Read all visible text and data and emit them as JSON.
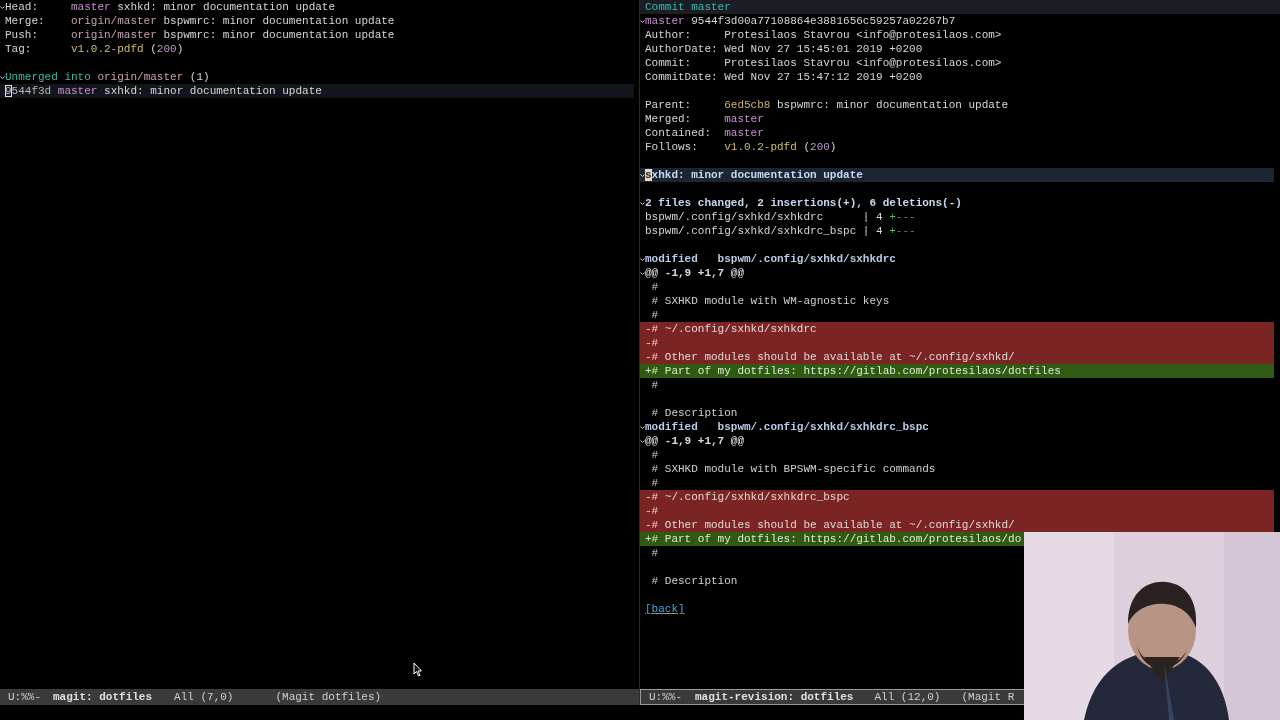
{
  "left": {
    "active": false,
    "lines": [
      {
        "kind": "field",
        "expanded": true,
        "label": "Head:",
        "segments": [
          {
            "kind": "branch",
            "t": "master"
          },
          {
            "kind": "text",
            "t": " sxhkd: minor documentation update"
          }
        ]
      },
      {
        "kind": "field",
        "label": "Merge:",
        "segments": [
          {
            "kind": "remote",
            "t": "origin/master"
          },
          {
            "kind": "text",
            "t": " bspwmrc: minor documentation update"
          }
        ]
      },
      {
        "kind": "field",
        "label": "Push:",
        "segments": [
          {
            "kind": "remote",
            "t": "origin/master"
          },
          {
            "kind": "text",
            "t": " bspwmrc: minor documentation update"
          }
        ]
      },
      {
        "kind": "field",
        "label": "Tag:",
        "segments": [
          {
            "kind": "tag",
            "t": "v1.0.2-pdfd"
          },
          {
            "kind": "text",
            "t": " ("
          },
          {
            "kind": "count",
            "t": "200"
          },
          {
            "kind": "text",
            "t": ")"
          }
        ]
      },
      {
        "kind": "blank"
      },
      {
        "kind": "plain",
        "expanded": true,
        "segments": [
          {
            "kind": "section",
            "t": "Unmerged into "
          },
          {
            "kind": "remote",
            "t": "origin/master"
          },
          {
            "kind": "text",
            "t": " (1)"
          }
        ]
      },
      {
        "kind": "current",
        "cursor": true,
        "segments": [
          {
            "kind": "hash",
            "t": "9544f3d"
          },
          {
            "kind": "branch",
            "t": " master"
          },
          {
            "kind": "text",
            "t": " sxhkd: minor documentation update"
          }
        ]
      }
    ],
    "mode_line": [
      {
        "t": "U:%%-",
        "bold": false
      },
      {
        "t": "magit: dotfiles",
        "bold": true
      },
      {
        "t": "All (7,0)",
        "bold": false
      },
      {
        "t": "(Magit dotfiles)",
        "bold": false
      }
    ]
  },
  "right": {
    "active": true,
    "header": "Commit master",
    "lines": [
      {
        "kind": "plain",
        "expanded": true,
        "segments": [
          {
            "kind": "branch",
            "t": "master"
          },
          {
            "kind": "text",
            "t": " 9544f3d00a77108864e3881656c59257a02267b7"
          }
        ]
      },
      {
        "kind": "field",
        "label": "Author:",
        "segments": [
          {
            "kind": "text",
            "t": "Protesilaos Stavrou <info@protesilaos.com>"
          }
        ]
      },
      {
        "kind": "field",
        "label": "AuthorDate:",
        "segments": [
          {
            "kind": "text",
            "t": "Wed Nov 27 15:45:01 2019 +0200"
          }
        ]
      },
      {
        "kind": "field",
        "label": "Commit:",
        "segments": [
          {
            "kind": "text",
            "t": "Protesilaos Stavrou <info@protesilaos.com>"
          }
        ]
      },
      {
        "kind": "field",
        "label": "CommitDate:",
        "segments": [
          {
            "kind": "text",
            "t": "Wed Nov 27 15:47:12 2019 +0200"
          }
        ]
      },
      {
        "kind": "blank"
      },
      {
        "kind": "field",
        "label": "Parent:",
        "segments": [
          {
            "kind": "parent",
            "t": "6ed5cb8"
          },
          {
            "kind": "text",
            "t": " bspwmrc: minor documentation update"
          }
        ]
      },
      {
        "kind": "field",
        "label": "Merged:",
        "segments": [
          {
            "kind": "branch",
            "t": "master"
          }
        ]
      },
      {
        "kind": "field",
        "label": "Contained:",
        "segments": [
          {
            "kind": "branch",
            "t": "master"
          }
        ]
      },
      {
        "kind": "field",
        "label": "Follows:",
        "segments": [
          {
            "kind": "tag",
            "t": "v1.0.2-pdfd"
          },
          {
            "kind": "text",
            "t": " ("
          },
          {
            "kind": "count",
            "t": "200"
          },
          {
            "kind": "text",
            "t": ")"
          }
        ]
      },
      {
        "kind": "blank"
      },
      {
        "kind": "message",
        "expanded": true,
        "cursor": true,
        "segments": [
          {
            "kind": "text",
            "t": "sxhkd: minor documentation update"
          }
        ]
      },
      {
        "kind": "blank"
      },
      {
        "kind": "stat-header",
        "expanded": true,
        "segments": [
          {
            "kind": "text",
            "t": "2 files changed, 2 insertions(+), 6 deletions(-)"
          }
        ]
      },
      {
        "kind": "plain",
        "segments": [
          {
            "kind": "text",
            "t": "bspwm/.config/sxhkd/sxhkdrc      | 4 "
          },
          {
            "kind": "add",
            "t": "+"
          },
          {
            "kind": "del",
            "t": "---"
          }
        ]
      },
      {
        "kind": "plain",
        "segments": [
          {
            "kind": "text",
            "t": "bspwm/.config/sxhkd/sxhkdrc_bspc | 4 "
          },
          {
            "kind": "add",
            "t": "+"
          },
          {
            "kind": "del",
            "t": "---"
          }
        ]
      },
      {
        "kind": "blank"
      },
      {
        "kind": "file",
        "expanded": true,
        "segments": [
          {
            "kind": "text",
            "t": "modified   bspwm/.config/sxhkd/sxhkdrc"
          }
        ]
      },
      {
        "kind": "hunk",
        "expanded": true,
        "segments": [
          {
            "kind": "text",
            "t": "@@ -1,9 +1,7 @@"
          }
        ]
      },
      {
        "kind": "context",
        "segments": [
          {
            "kind": "text",
            "t": " #"
          }
        ]
      },
      {
        "kind": "context",
        "segments": [
          {
            "kind": "text",
            "t": " # SXHKD module with WM-agnostic keys"
          }
        ]
      },
      {
        "kind": "context",
        "segments": [
          {
            "kind": "text",
            "t": " #"
          }
        ]
      },
      {
        "kind": "removed",
        "segments": [
          {
            "kind": "text",
            "t": "-# ~/.config/sxhkd/sxhkdrc"
          }
        ]
      },
      {
        "kind": "removed",
        "segments": [
          {
            "kind": "text",
            "t": "-#"
          }
        ]
      },
      {
        "kind": "removed",
        "segments": [
          {
            "kind": "text",
            "t": "-# Other modules should be available at ~/.config/sxhkd/"
          }
        ]
      },
      {
        "kind": "added",
        "segments": [
          {
            "kind": "text",
            "t": "+# Part of my dotfiles: https://gitlab.com/protesilaos/dotfiles"
          }
        ]
      },
      {
        "kind": "context",
        "segments": [
          {
            "kind": "text",
            "t": " #"
          }
        ]
      },
      {
        "kind": "blank"
      },
      {
        "kind": "context",
        "segments": [
          {
            "kind": "text",
            "t": " # Description"
          }
        ]
      },
      {
        "kind": "file",
        "expanded": true,
        "segments": [
          {
            "kind": "text",
            "t": "modified   bspwm/.config/sxhkd/sxhkdrc_bspc"
          }
        ]
      },
      {
        "kind": "hunk",
        "expanded": true,
        "segments": [
          {
            "kind": "text",
            "t": "@@ -1,9 +1,7 @@"
          }
        ]
      },
      {
        "kind": "context",
        "segments": [
          {
            "kind": "text",
            "t": " #"
          }
        ]
      },
      {
        "kind": "context",
        "segments": [
          {
            "kind": "text",
            "t": " # SXHKD module with BPSWM-specific commands"
          }
        ]
      },
      {
        "kind": "context",
        "segments": [
          {
            "kind": "text",
            "t": " #"
          }
        ]
      },
      {
        "kind": "removed",
        "segments": [
          {
            "kind": "text",
            "t": "-# ~/.config/sxhkd/sxhkdrc_bspc"
          }
        ]
      },
      {
        "kind": "removed",
        "segments": [
          {
            "kind": "text",
            "t": "-#"
          }
        ]
      },
      {
        "kind": "removed",
        "segments": [
          {
            "kind": "text",
            "t": "-# Other modules should be available at ~/.config/sxhkd/"
          }
        ]
      },
      {
        "kind": "added",
        "segments": [
          {
            "kind": "text",
            "t": "+# Part of my dotfiles: https://gitlab.com/protesilaos/do"
          }
        ]
      },
      {
        "kind": "context",
        "segments": [
          {
            "kind": "text",
            "t": " #"
          }
        ]
      },
      {
        "kind": "blank"
      },
      {
        "kind": "context",
        "segments": [
          {
            "kind": "text",
            "t": " # Description"
          }
        ]
      },
      {
        "kind": "blank"
      },
      {
        "kind": "link",
        "segments": [
          {
            "kind": "text",
            "t": "[back]"
          }
        ]
      }
    ],
    "mode_line": [
      {
        "t": "U:%%-",
        "bold": false
      },
      {
        "t": "magit-revision: dotfiles",
        "bold": true
      },
      {
        "t": "All (12,0)",
        "bold": false
      },
      {
        "t": "(Magit R",
        "bold": false
      }
    ]
  }
}
